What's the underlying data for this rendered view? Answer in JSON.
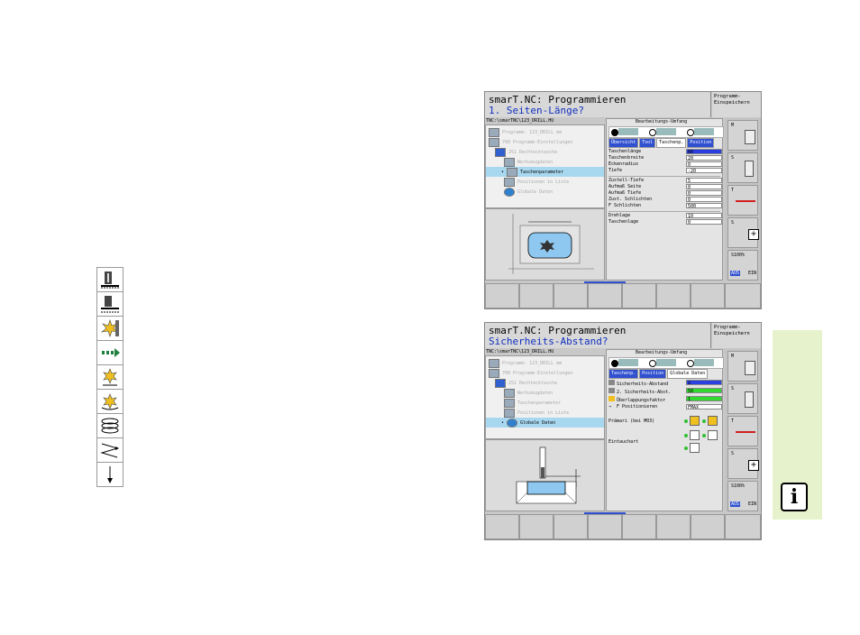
{
  "screen1": {
    "title1": "smarT.NC: Programmieren",
    "title2": "1. Seiten-Länge?",
    "right_header": [
      "Programm-",
      "Einspeichern"
    ],
    "path": "TNC:\\smarTNC\\123_DRILL.HU",
    "tree": [
      {
        "label": "Programm: 123_DRILL mm",
        "prefix": "0"
      },
      {
        "label": "700 Programm-Einstellungen",
        "prefix": "1"
      },
      {
        "label": "251 Rechtecktasche",
        "prefix": "2"
      },
      {
        "label": "Werkzeugdaten",
        "prefix": ""
      },
      {
        "label": "Taschenparameter",
        "prefix": ""
      },
      {
        "label": "Positionen in Liste",
        "prefix": ""
      },
      {
        "label": "Globale Daten",
        "prefix": ""
      }
    ],
    "form_title": "Bearbeitungs-Umfang",
    "tabs": [
      "Übersicht",
      "Tool",
      "Taschenp.",
      "Position"
    ],
    "rows": [
      {
        "label": "Taschenlänge",
        "value": "60"
      },
      {
        "label": "Taschenbreite",
        "value": "20"
      },
      {
        "label": "Eckenradius",
        "value": "0"
      },
      {
        "label": "Tiefe",
        "value": "-20"
      },
      {
        "label": "Zustell-Tiefe",
        "value": "5"
      },
      {
        "label": "Aufmaß Seite",
        "value": "0"
      },
      {
        "label": "Aufmaß Tiefe",
        "value": "0"
      },
      {
        "label": "Zust. Schlichten",
        "value": "0"
      },
      {
        "label": "F Schlichten",
        "value": "500"
      },
      {
        "label": "Drehlage",
        "value": "10"
      },
      {
        "label": "Taschenlage",
        "value": "0"
      }
    ],
    "side_labels": [
      "M",
      "S",
      "T",
      "S",
      "S100%",
      "S"
    ],
    "s100": "S100%",
    "aus": "AUS",
    "ein": "EIN"
  },
  "screen2": {
    "title1": "smarT.NC: Programmieren",
    "title2": "Sicherheits-Abstand?",
    "right_header": [
      "Programm-",
      "Einspeichern"
    ],
    "path": "TNC:\\smarTNC\\123_DRILL.HU",
    "tree": [
      {
        "label": "Programm: 123_DRILL mm",
        "prefix": "0"
      },
      {
        "label": "700 Programm-Einstellungen",
        "prefix": "1"
      },
      {
        "label": "251 Rechtecktasche",
        "prefix": "2"
      },
      {
        "label": "Werkzeugdaten",
        "prefix": ""
      },
      {
        "label": "Taschenparameter",
        "prefix": ""
      },
      {
        "label": "Positionen in Liste",
        "prefix": ""
      },
      {
        "label": "Globale Daten",
        "prefix": ""
      }
    ],
    "form_title": "Bearbeitungs-Umfang",
    "tabs": [
      "Taschenp.",
      "Position",
      "Globale Daten"
    ],
    "rows": [
      {
        "label": "Sicherheits-Abstand",
        "value": "2"
      },
      {
        "label": "2. Sicherheits-Abst.",
        "value": "50"
      },
      {
        "label": "Überlappungsfaktor",
        "value": "1"
      },
      {
        "label": "F Positionieren",
        "value": "FMAX"
      }
    ],
    "primary_label": "Prämari (bei M03)",
    "plunge_label": "Eintauchart",
    "s100": "S100%",
    "aus": "AUS",
    "ein": "EIN"
  },
  "info_icon": "i"
}
